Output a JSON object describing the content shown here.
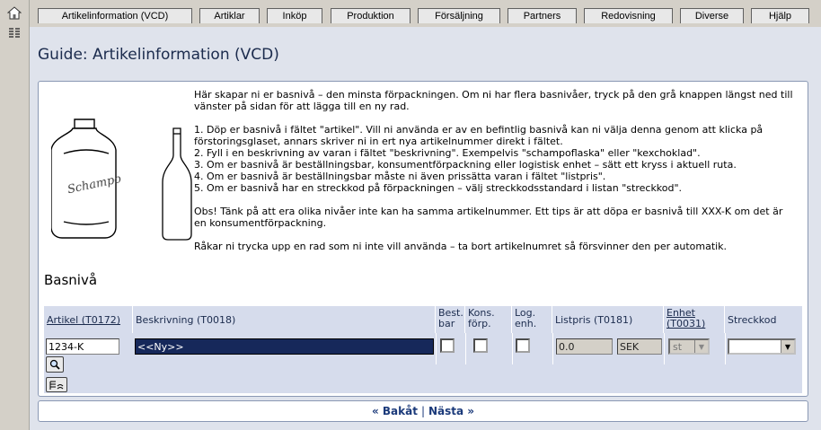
{
  "leftbar": {
    "icons": [
      "home-icon",
      "list-icon"
    ]
  },
  "tabs": [
    {
      "label": "Artikelinformation (VCD)"
    },
    {
      "label": "Artiklar"
    },
    {
      "label": "Inköp"
    },
    {
      "label": "Produktion"
    },
    {
      "label": "Försäljning"
    },
    {
      "label": "Partners"
    },
    {
      "label": "Redovisning"
    },
    {
      "label": "Diverse"
    },
    {
      "label": "Hjälp"
    }
  ],
  "page": {
    "title": "Guide: Artikelinformation (VCD)",
    "intro": "Här skapar ni er basnivå – den minsta förpackningen. Om ni har flera basnivåer, tryck på den grå knappen längst ned till vänster på sidan för att lägga till en ny rad.",
    "steps": [
      "1. Döp er basnivå i fältet \"artikel\". Vill ni använda er av en befintlig basnivå kan ni välja denna genom att klicka på",
      "förstoringsglaset, annars skriver ni in ert nya artikelnummer direkt i fältet.",
      "2. Fyll i en beskrivning av varan i fältet \"beskrivning\". Exempelvis \"schampoflaska\" eller \"kexchoklad\".",
      "3. Om er basnivå är beställningsbar, konsumentförpackning eller logistisk enhet – sätt ett kryss i aktuell ruta.",
      "4. Om er basnivå är beställningsbar måste ni även prissätta varan i fältet \"listpris\".",
      "5. Om er basnivå har en streckkod på förpackningen – välj streckkodsstandard i listan \"streckkod\"."
    ],
    "note": "Obs! Tänk på att era olika nivåer inte kan ha samma artikelnummer. Ett tips är att döpa er basnivå till XXX-K om det är en konsumentförpackning.",
    "note2": "Råkar ni trycka upp en rad som ni inte vill använda – ta bort artikelnumret så försvinner den per automatik.",
    "bottle_label": "Schampo"
  },
  "section": {
    "title": "Basnivå"
  },
  "grid": {
    "headers": {
      "artikel": "Artikel (T0172)",
      "beskrivning": "Beskrivning (T0018)",
      "best_1": "Best.",
      "best_2": "bar",
      "kons_1": "Kons.",
      "kons_2": "förp.",
      "log_1": "Log.",
      "log_2": "enh.",
      "listpris": "Listpris (T0181)",
      "enhet_1": "Enhet",
      "enhet_2": "(T0031)",
      "streckkod": "Streckkod"
    },
    "row": {
      "artikel": "1234-K",
      "beskrivning": "<<Ny>>",
      "listpris": "0.0",
      "valuta": "SEK",
      "enhet": "st",
      "streckkod": ""
    }
  },
  "nav": {
    "back": "« Bakåt",
    "separator": "|",
    "next": "Nästa »"
  }
}
